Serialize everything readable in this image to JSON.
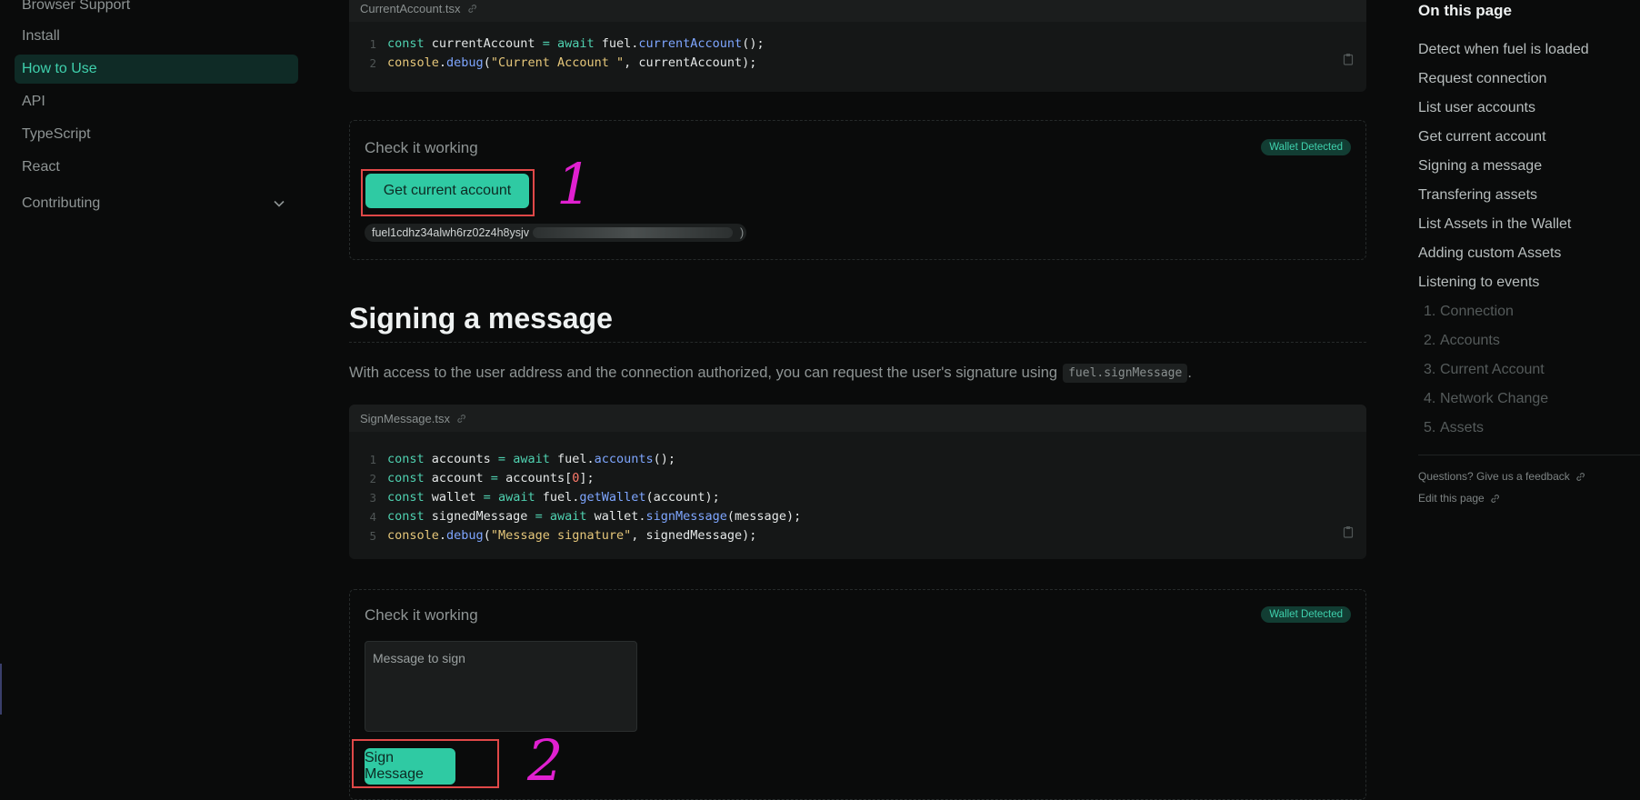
{
  "sidebar": {
    "items": [
      {
        "label": "Browser Support"
      },
      {
        "label": "Install"
      },
      {
        "label": "How to Use"
      },
      {
        "label": "API"
      },
      {
        "label": "TypeScript"
      },
      {
        "label": "React"
      },
      {
        "label": "Contributing"
      }
    ]
  },
  "code1": {
    "filename": "CurrentAccount.tsx",
    "line_numbers": [
      "1",
      "2"
    ]
  },
  "check1": {
    "title": "Check it working",
    "badge": "Wallet Detected",
    "button_label": "Get current account",
    "address_visible": "fuel1cdhz34alwh6rz02z4h8ysjv",
    "address_end": ")"
  },
  "section": {
    "title": "Signing a message",
    "paragraph": "With access to the user address and the connection authorized, you can request the user's signature using",
    "inline_code": "fuel.signMessage",
    "paragraph_end": "."
  },
  "code2": {
    "filename": "SignMessage.tsx",
    "line_numbers": [
      "1",
      "2",
      "3",
      "4",
      "5"
    ]
  },
  "check2": {
    "title": "Check it working",
    "badge": "Wallet Detected",
    "textarea_placeholder": "Message to sign",
    "button_label": "Sign Message"
  },
  "annotations": {
    "marker1": "1",
    "marker2": "2",
    "marker_color": "#e020d0"
  },
  "toc": {
    "title": "On this page",
    "items": [
      {
        "label": "Detect when fuel is loaded"
      },
      {
        "label": "Request connection"
      },
      {
        "label": "List user accounts"
      },
      {
        "label": "Get current account"
      },
      {
        "label": "Signing a message"
      },
      {
        "label": "Transfering assets"
      },
      {
        "label": "List Assets in the Wallet"
      },
      {
        "label": "Adding custom Assets"
      },
      {
        "label": "Listening to events"
      }
    ],
    "sub_items": [
      {
        "num": "1.",
        "label": "Connection"
      },
      {
        "num": "2.",
        "label": "Accounts"
      },
      {
        "num": "3.",
        "label": "Current Account"
      },
      {
        "num": "4.",
        "label": "Network Change"
      },
      {
        "num": "5.",
        "label": "Assets"
      }
    ],
    "feedback_link": "Questions? Give us a feedback",
    "edit_link": "Edit this page"
  },
  "colors": {
    "accent": "#2fcaa3",
    "background": "#0a0b0b",
    "highlight_box": "#e04848"
  }
}
